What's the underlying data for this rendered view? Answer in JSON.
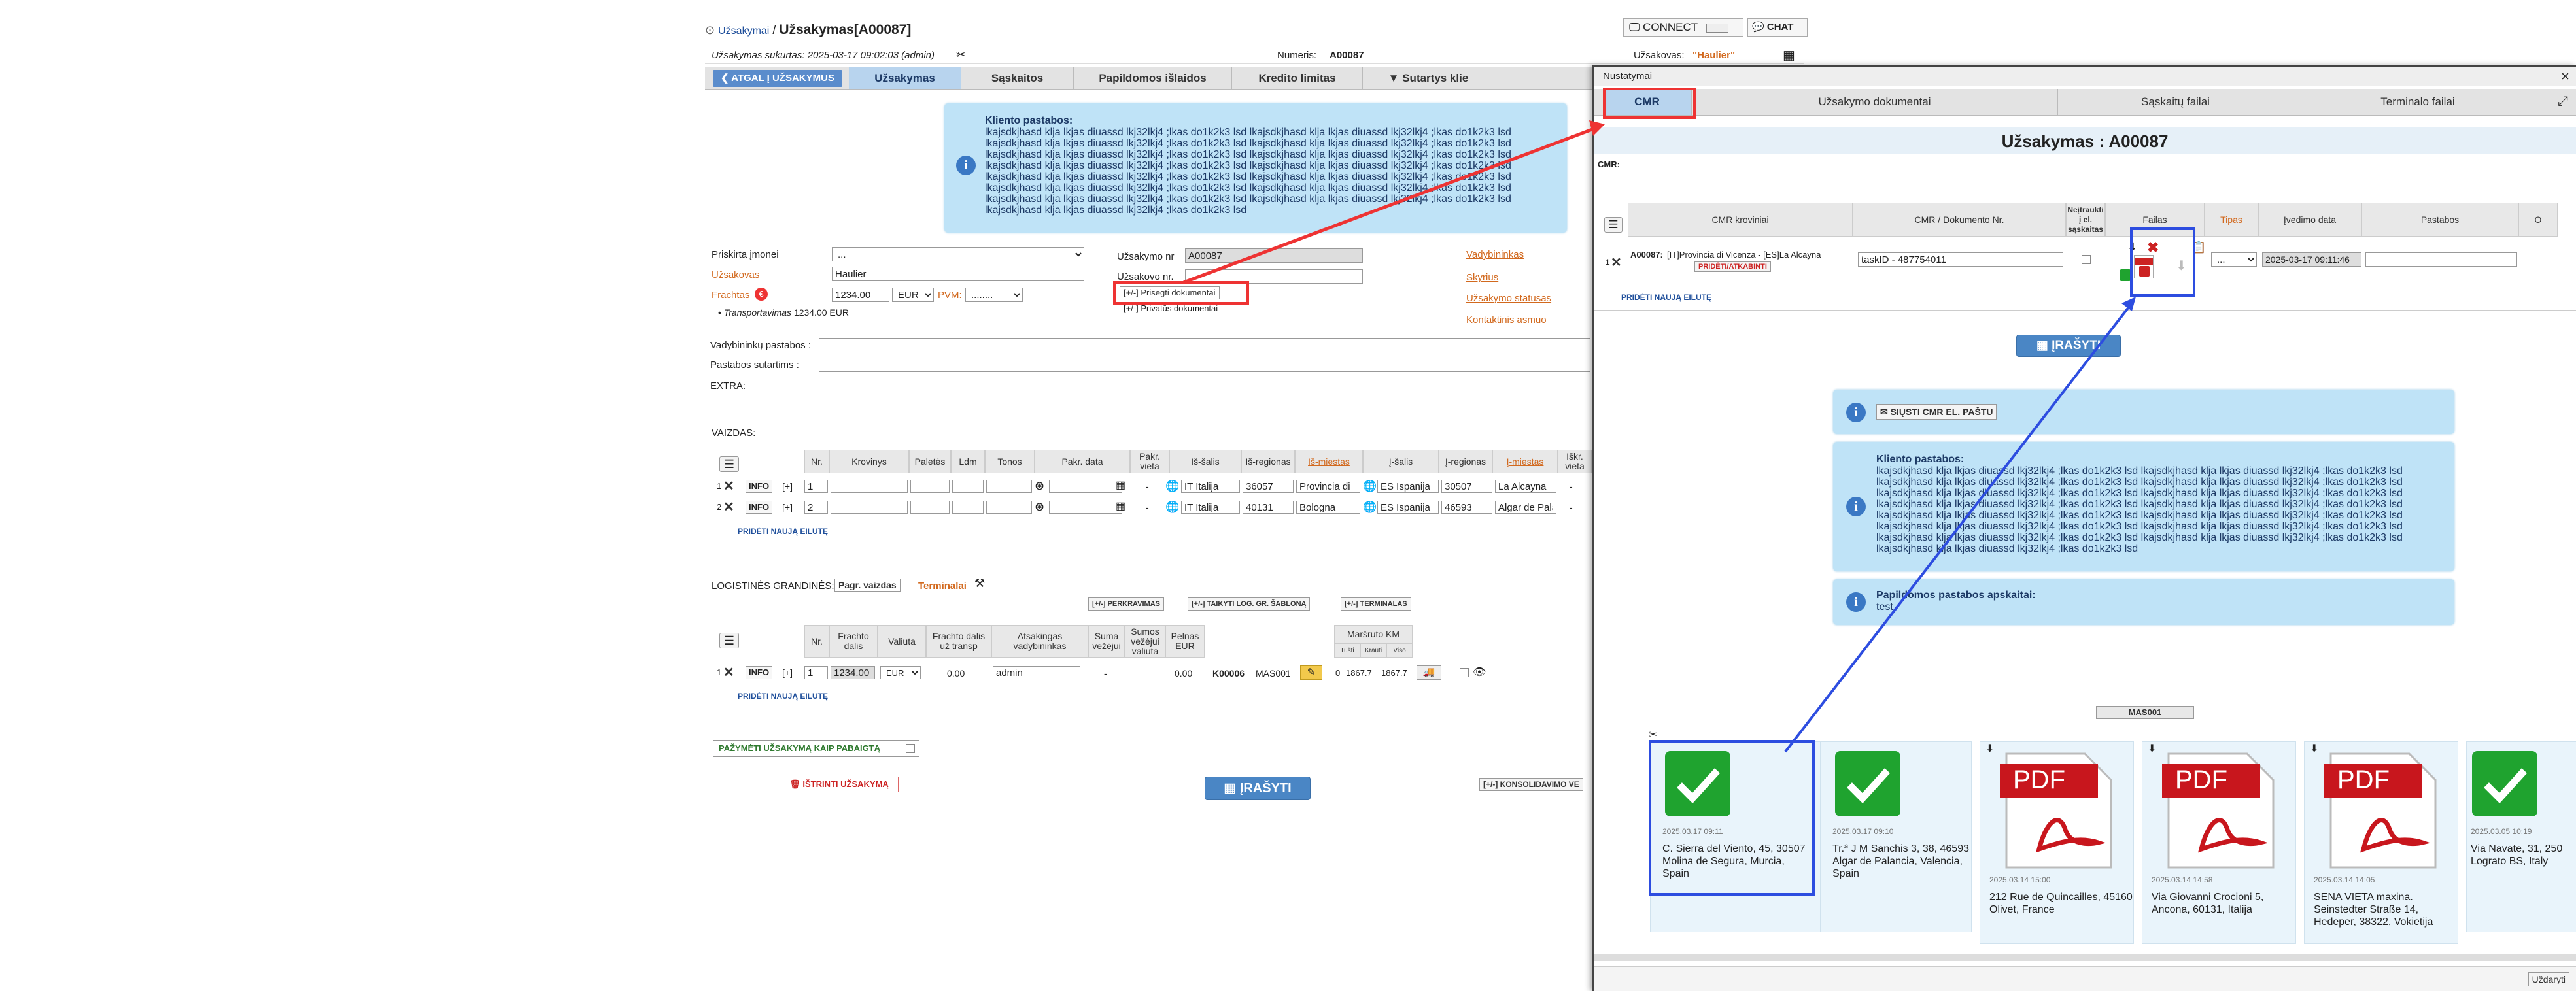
{
  "breadcrumb": {
    "parent": "Užsakymai",
    "sep": "/",
    "title": "Užsakymas[A00087]"
  },
  "header": {
    "connect_label": "CONNECT",
    "chat_label": "CHAT",
    "created": "Užsakymas sukurtas: 2025-03-17 09:02:03 (admin)",
    "numeris_label": "Numeris:",
    "numeris_value": "A00087",
    "uzsakovas_label": "Užsakovas:",
    "uzsakovas_value": "\"Haulier\""
  },
  "main_tabs": {
    "back": "ATGAL Į UŽSAKYMUS",
    "items": [
      "Užsakymas",
      "Sąskaitos",
      "Papildomos išlaidos",
      "Kredito limitas",
      "Sutartys klie"
    ]
  },
  "client_note": {
    "title": "Kliento pastabos:",
    "text": "lkajsdkjhasd klja lkjas diuassd lkj32lkj4 ;lkas do1k2k3 lsd lkajsdkjhasd klja lkjas diuassd lkj32lkj4 ;lkas do1k2k3 lsd lkajsdkjhasd klja lkjas diuassd lkj32lkj4 ;lkas do1k2k3 lsd lkajsdkjhasd klja lkjas diuassd lkj32lkj4 ;lkas do1k2k3 lsd lkajsdkjhasd klja lkjas diuassd lkj32lkj4 ;lkas do1k2k3 lsd lkajsdkjhasd klja lkjas diuassd lkj32lkj4 ;lkas do1k2k3 lsd lkajsdkjhasd klja lkjas diuassd lkj32lkj4 ;lkas do1k2k3 lsd lkajsdkjhasd klja lkjas diuassd lkj32lkj4 ;lkas do1k2k3 lsd lkajsdkjhasd klja lkjas diuassd lkj32lkj4 ;lkas do1k2k3 lsd lkajsdkjhasd klja lkjas diuassd lkj32lkj4 ;lkas do1k2k3 lsd lkajsdkjhasd klja lkjas diuassd lkj32lkj4 ;lkas do1k2k3 lsd lkajsdkjhasd klja lkjas diuassd lkj32lkj4 ;lkas do1k2k3 lsd lkajsdkjhasd klja lkjas diuassd lkj32lkj4 ;lkas do1k2k3 lsd lkajsdkjhasd klja lkjas diuassd lkj32lkj4 ;lkas do1k2k3 lsd lkajsdkjhasd klja lkjas diuassd lkj32lkj4 ;lkas do1k2k3 lsd"
  },
  "form": {
    "priskirta_label": "Priskirta įmonei",
    "priskirta_value": "...",
    "uzsakovas_label": "Užsakovas",
    "uzsakovas_value": "Haulier",
    "frachtas_label": "Frachtas",
    "frachtas_badge": "€",
    "frachtas_value": "1234.00",
    "currency": "EUR",
    "pvm_label": "PVM:",
    "pvm_value": "........",
    "transport_label": "Transportavimas",
    "transport_value": "1234.00 EUR",
    "uzsakymo_nr_label": "Užsakymo nr",
    "uzsakymo_nr_value": "A00087",
    "uzsakovo_nr_label": "Užsakovo nr.",
    "attach_label": "[+/-] Prisegti dokumentai",
    "private_docs_label": "[+/-] Privatūs dokumentai",
    "vadybininkas": "Vadybininkas",
    "skyrius": "Skyrius",
    "statusas": "Užsakymo statusas",
    "kontaktinis": "Kontaktinis asmuo",
    "vad_pastabos": "Vadybininkų pastabos :",
    "sutartims_pastabos": "Pastabos sutartims :",
    "extra": "EXTRA:"
  },
  "cargo": {
    "title": "VAIZDAS:",
    "headers": [
      "Nr.",
      "Krovinys",
      "Paletės",
      "Ldm",
      "Tonos",
      "Pakr. data",
      "Pakr. vieta",
      "Iš-šalis",
      "Iš-regionas",
      "Iš-miestas",
      "Į-šalis",
      "Į-regionas",
      "Į-miestas",
      "Iškr. vieta"
    ],
    "rows": [
      {
        "idx": "1",
        "nr": "1",
        "from_country": "IT Italija",
        "from_region": "36057",
        "from_city": "Provincia di",
        "to_country": "ES Ispanija",
        "to_region": "30507",
        "to_city": "La Alcayna",
        "dash": "-",
        "tail": "-"
      },
      {
        "idx": "2",
        "nr": "2",
        "from_country": "IT Italija",
        "from_region": "40131",
        "from_city": "Bologna",
        "to_country": "ES Ispanija",
        "to_region": "46593",
        "to_city": "Algar de Pala",
        "dash": "-",
        "tail": "-"
      }
    ],
    "add_row": "PRIDĖTI NAUJĄ EILUTĘ",
    "info": "INFO",
    "plus": "[+]"
  },
  "chain": {
    "title": "LOGISTINĖS GRANDINĖS:",
    "pagr": "Pagr. vaizdas",
    "terminalai": "Terminalai",
    "btn_perkrovimas": "[+/-] PERKRAVIMAS",
    "btn_taikyti": "[+/-] TAIKYTI LOG. GR. ŠABLONĄ",
    "btn_terminalas": "[+/-] TERMINALAS",
    "headers": [
      "Nr.",
      "Frachto dalis",
      "Valiuta",
      "Frachto dalis už transp",
      "Atsakingas vadybininkas",
      "Suma vežėjui",
      "Sumos vežėjui valiuta",
      "Pelnas EUR",
      "Maršruto KM"
    ],
    "km_sub": [
      "Tušti",
      "Krauti",
      "Viso"
    ],
    "row": {
      "idx": "1",
      "nr": "1",
      "fracht": "1234.00",
      "currency": "EUR",
      "transp": "0.00",
      "manager": "admin",
      "dash": "-",
      "profit": "0.00",
      "code": "K00006",
      "code2": "MAS001",
      "km_empty": "0",
      "km_loaded": "1867.7",
      "km_total": "1867.7"
    },
    "add_row": "PRIDĖTI NAUJĄ EILUTĘ"
  },
  "footer": {
    "mark_done": "PAŽYMĖTI UŽSAKYMĄ KAIP PABAIGTĄ",
    "delete": "IŠTRINTI UŽSAKYMĄ",
    "save": "ĮRAŠYTI",
    "konsolid": "[+/-] KONSOLIDAVIMO VE"
  },
  "modal": {
    "title": "Nustatymai",
    "close": "×",
    "tabs": [
      "CMR",
      "Užsakymo dokumentai",
      "Sąskaitų failai",
      "Terminalo failai"
    ],
    "heading": "Užsakymas : A00087",
    "cmr_label": "CMR:",
    "headers": [
      "CMR kroviniai",
      "CMR / Dokumento Nr.",
      "Neįtraukti į el. sąskaitas",
      "Failas",
      "Tipas",
      "Įvedimo data",
      "Pastabos",
      "O"
    ],
    "row": {
      "idx": "1",
      "cargo_code": "A00087:",
      "cargo_text": "[IT]Provincia di Vicenza - [ES]La Alcayna",
      "cargo_btn": "PRIDĖTI/ATKABINTI",
      "doc_nr": "taskID - 487754011",
      "tipas": "...",
      "date": "2025-03-17 09:11:46"
    },
    "add_row": "PRIDĖTI NAUJĄ EILUTĘ",
    "save": "ĮRAŠYTI",
    "send_cmr": "SIŲSTI CMR EL. PAŠTU",
    "extra_title": "Papildomos pastabos apskaitai:",
    "extra_text": "test",
    "mas_tag": "MAS001",
    "cards": [
      {
        "kind": "check",
        "date": "2025.03.17 09:11",
        "addr": "C. Sierra del Viento, 45, 30507 Molina de Segura, Murcia, Spain"
      },
      {
        "kind": "check",
        "date": "2025.03.17 09:10",
        "addr": "Tr.ª J M Sanchis 3, 38, 46593 Algar de Palancia, Valencia, Spain"
      },
      {
        "kind": "pdf",
        "date": "2025.03.14 15:00",
        "addr": "212 Rue de Quincailles, 45160 Olivet, France"
      },
      {
        "kind": "pdf",
        "date": "2025.03.14 14:58",
        "addr": "Via Giovanni Crocioni 5, Ancona, 60131, Italija"
      },
      {
        "kind": "pdf",
        "date": "2025.03.14 14:05",
        "addr": "SENA VIETA maxina. Seinstedter Straße 14, Hedeper, 38322, Vokietija"
      },
      {
        "kind": "check",
        "date": "2025.03.05 10:19",
        "addr": "Via Navate, 31, 250 Lograto BS, Italy"
      }
    ],
    "pdf_label": "PDF",
    "close_btn": "Uždaryti"
  }
}
